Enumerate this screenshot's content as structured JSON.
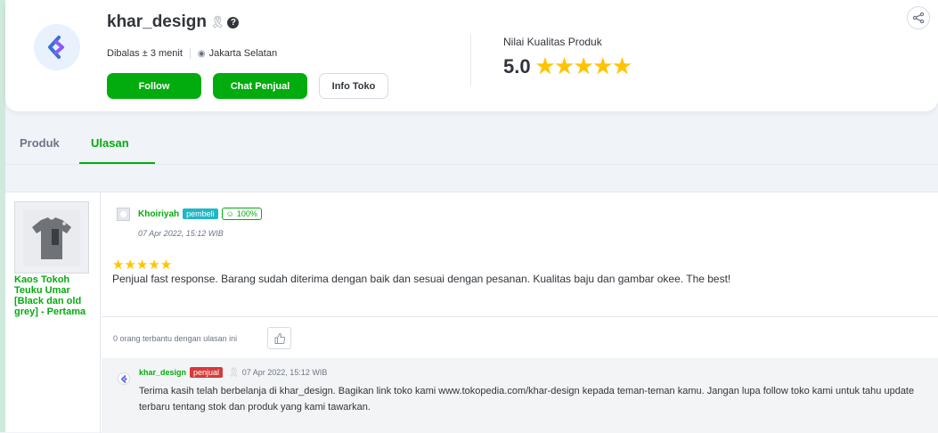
{
  "shop": {
    "name": "khar_design",
    "response_time": "Dibalas ± 3 menit",
    "location": "Jakarta Selatan",
    "follow_label": "Follow",
    "chat_label": "Chat Penjual",
    "info_label": "Info Toko",
    "quality_label": "Nilai Kualitas Produk",
    "quality_score": "5.0",
    "quality_stars": "★★★★★"
  },
  "tabs": [
    {
      "label": "Produk"
    },
    {
      "label": "Ulasan"
    }
  ],
  "review": {
    "product_name": "Kaos Tokoh Teuku Umar [Black dan old grey] - Pertama",
    "reviewer": "Khoiriyah",
    "reviewer_tag": "pembeli",
    "satisfaction": "100%",
    "date": "07 Apr 2022, 15:12 WIB",
    "stars": "★★★★★",
    "rating": 5,
    "text": "Penjual fast response. Barang sudah diterima dengan baik dan sesuai dengan pesanan. Kualitas baju dan gambar okee. The best!",
    "helpful_text": "0 orang terbantu dengan ulasan ini",
    "reply": {
      "name": "khar_design",
      "tag": "penjual",
      "date": "07 Apr 2022, 15:12 WIB",
      "text": "Terima kasih telah berbelanja di khar_design. Bagikan link toko kami www.tokopedia.com/khar-design kepada teman-teman kamu. Jangan lupa follow toko kami untuk tahu update terbaru tentang stok dan produk yang kami tawarkan."
    }
  },
  "colors": {
    "brand_green": "#03ac0e",
    "star": "#ffc400",
    "buyer_tag": "#22b7c5",
    "seller_tag": "#d63a3a"
  }
}
